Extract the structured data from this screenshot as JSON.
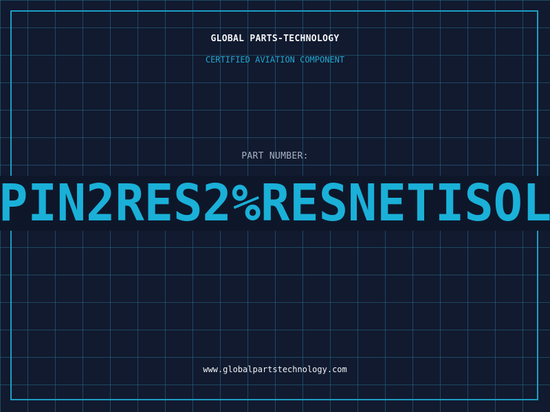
{
  "header": {
    "brand": "GLOBAL PARTS-TECHNOLOGY",
    "subtitle": "CERTIFIED AVIATION COMPONENT"
  },
  "part": {
    "label": "PART NUMBER:",
    "number": "PIN2RES2%RESNETISOL"
  },
  "footer": {
    "url": "www.globalpartstechnology.com"
  },
  "colors": {
    "background": "#111a2f",
    "grid": "#286e8c",
    "frame": "#1e9ec4",
    "accent": "#1ab0d8",
    "label": "#a7b2c2",
    "text": "#f2f4f7"
  }
}
